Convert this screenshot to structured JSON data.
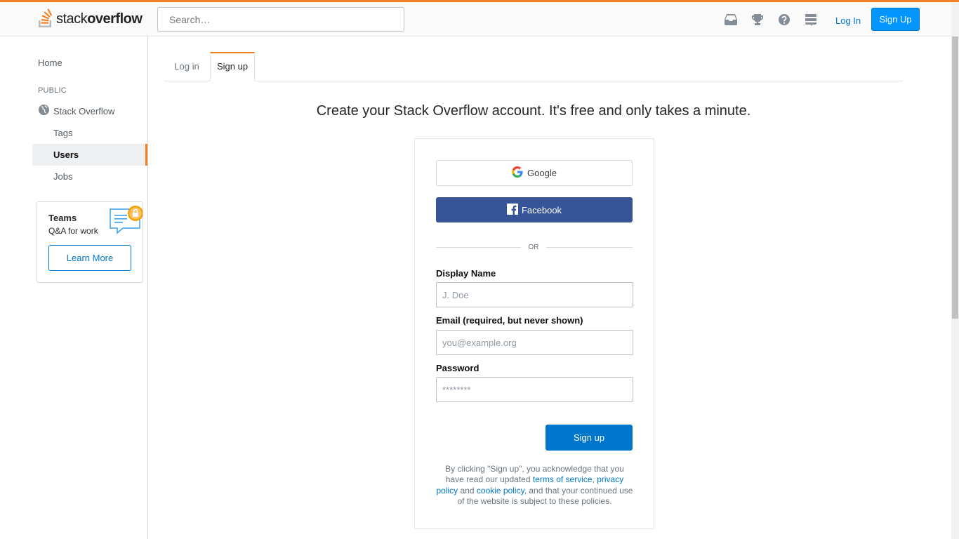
{
  "header": {
    "logo": {
      "word_light": "stack",
      "word_bold": "overflow",
      "icon": "stack-overflow-logo-icon"
    },
    "search_placeholder": "Search…",
    "icons": [
      "inbox-icon",
      "trophy-icon",
      "help-icon",
      "stack-exchange-icon"
    ],
    "login_label": "Log In",
    "signup_label": "Sign Up",
    "accent": "#f48024",
    "primary": "#0095ff"
  },
  "sidebar": {
    "home": "Home",
    "public_heading": "PUBLIC",
    "stackoverflow": "Stack Overflow",
    "tags": "Tags",
    "users": "Users",
    "jobs": "Jobs",
    "teams": {
      "title": "Teams",
      "subtitle": "Q&A for work",
      "button": "Learn More"
    }
  },
  "tabs": {
    "login": "Log in",
    "signup": "Sign up",
    "active": "signup"
  },
  "main": {
    "headline": "Create your Stack Overflow account. It's free and only takes a minute.",
    "google_label": "Google",
    "facebook_label": "Facebook",
    "facebook_color": "#385499",
    "or_label": "OR",
    "display_name": {
      "label": "Display Name",
      "placeholder": "J. Doe",
      "value": ""
    },
    "email": {
      "label": "Email (required, but never shown)",
      "placeholder": "you@example.org",
      "value": ""
    },
    "password": {
      "label": "Password",
      "placeholder": "********",
      "value": ""
    },
    "submit_label": "Sign up",
    "legal": {
      "p1": "By clicking \"Sign up\", you acknowledge that you have read our updated ",
      "terms": "terms of service",
      "sep1": ", ",
      "privacy": "privacy policy",
      "and": " and ",
      "cookie": "cookie policy",
      "p2": ", and that your continued use of the website is subject to these policies."
    }
  }
}
